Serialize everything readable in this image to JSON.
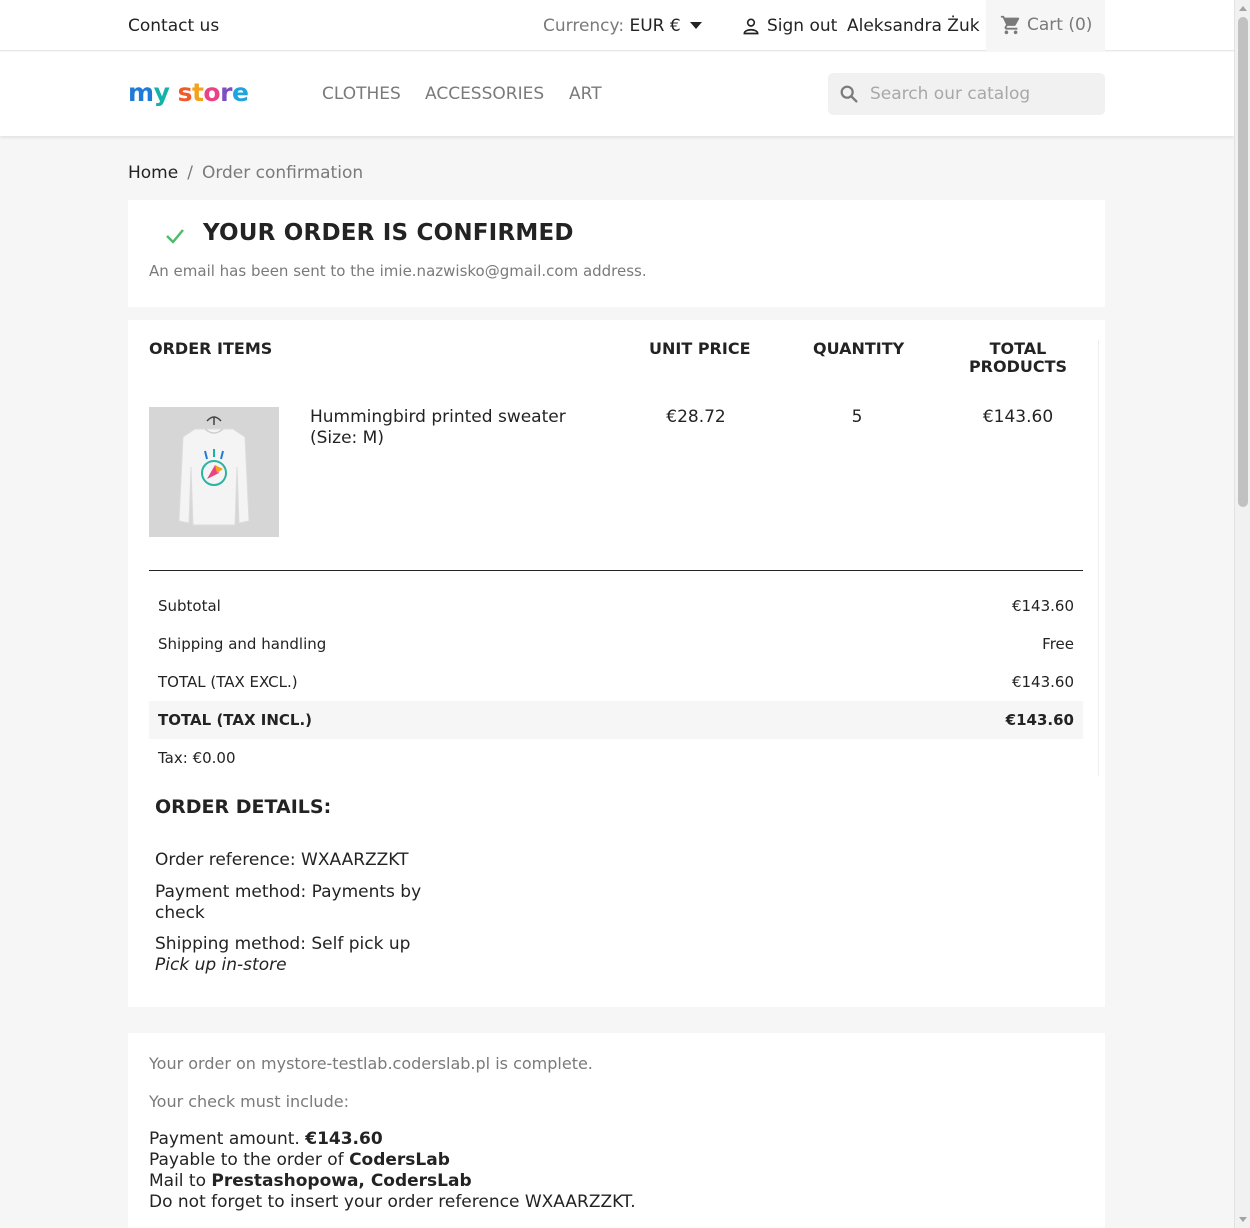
{
  "topbar": {
    "contact": "Contact us",
    "currency_label": "Currency:",
    "currency_value": "EUR €",
    "signout": "Sign out",
    "username": "Aleksandra Żuk",
    "cart": "Cart (0)"
  },
  "header": {
    "logo_text": "my store",
    "nav": [
      "CLOTHES",
      "ACCESSORIES",
      "ART"
    ],
    "search_placeholder": "Search our catalog"
  },
  "breadcrumb": {
    "home": "Home",
    "separator": "/",
    "current": "Order confirmation"
  },
  "confirmation": {
    "title": "YOUR ORDER IS CONFIRMED",
    "message": "An email has been sent to the imie.nazwisko@gmail.com address."
  },
  "order_table": {
    "headers": {
      "items": "ORDER ITEMS",
      "unit_price": "UNIT PRICE",
      "quantity": "QUANTITY",
      "total_line1": "TOTAL",
      "total_line2": "PRODUCTS"
    },
    "items": [
      {
        "name": "Hummingbird printed sweater (Size: M)",
        "unit_price": "€28.72",
        "quantity": "5",
        "total": "€143.60"
      }
    ],
    "totals": [
      {
        "label": "Subtotal",
        "value": "€143.60"
      },
      {
        "label": "Shipping and handling",
        "value": "Free"
      },
      {
        "label": "TOTAL (TAX EXCL.)",
        "value": "€143.60"
      },
      {
        "label": "TOTAL (TAX INCL.)",
        "value": "€143.60"
      }
    ],
    "tax": "Tax: €0.00"
  },
  "order_details": {
    "title": "ORDER DETAILS:",
    "reference": "Order reference: WXAARZZKT",
    "payment": "Payment method: Payments by check",
    "shipping": "Shipping method: Self pick up",
    "shipping_note": "Pick up in-store"
  },
  "payment_info": {
    "complete": "Your order on mystore-testlab.coderslab.pl is complete.",
    "check_include": "Your check must include:",
    "amount_label": "Payment amount.",
    "amount_value": "€143.60",
    "payable_label": "Payable to the order of",
    "payable_value": "CodersLab",
    "mail_label": "Mail to",
    "mail_value": "Prestashopowa, CodersLab",
    "reference_note": "Do not forget to insert your order reference WXAARZZKT."
  },
  "colors": {
    "accent_green": "#4cbb6c",
    "text_dark": "#232323",
    "text_muted": "#7a7a7a"
  }
}
